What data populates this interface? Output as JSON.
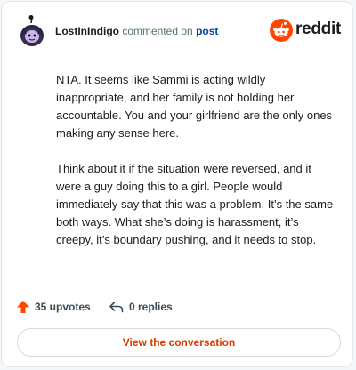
{
  "header": {
    "username": "LostInIndigo",
    "action_text": "commented on",
    "post_link": "post",
    "brand": "reddit"
  },
  "comment": {
    "paragraphs": [
      "NTA. It seems like Sammi is acting wildly inappropriate, and her family is not holding her accountable. You and your girlfriend are the only ones making any sense here.",
      "Think about it if the situation were reversed, and it were a guy doing this to a girl. People would immediately say that this was a problem. It’s the same both ways. What she’s doing is harassment, it’s creepy, it’s boundary pushing, and it needs to stop."
    ]
  },
  "footer": {
    "upvotes": "35 upvotes",
    "replies": "0 replies"
  },
  "cta": {
    "label": "View the conversation"
  },
  "colors": {
    "accent": "#d93a00",
    "upvote": "#ff4500",
    "link": "#0045ac"
  }
}
